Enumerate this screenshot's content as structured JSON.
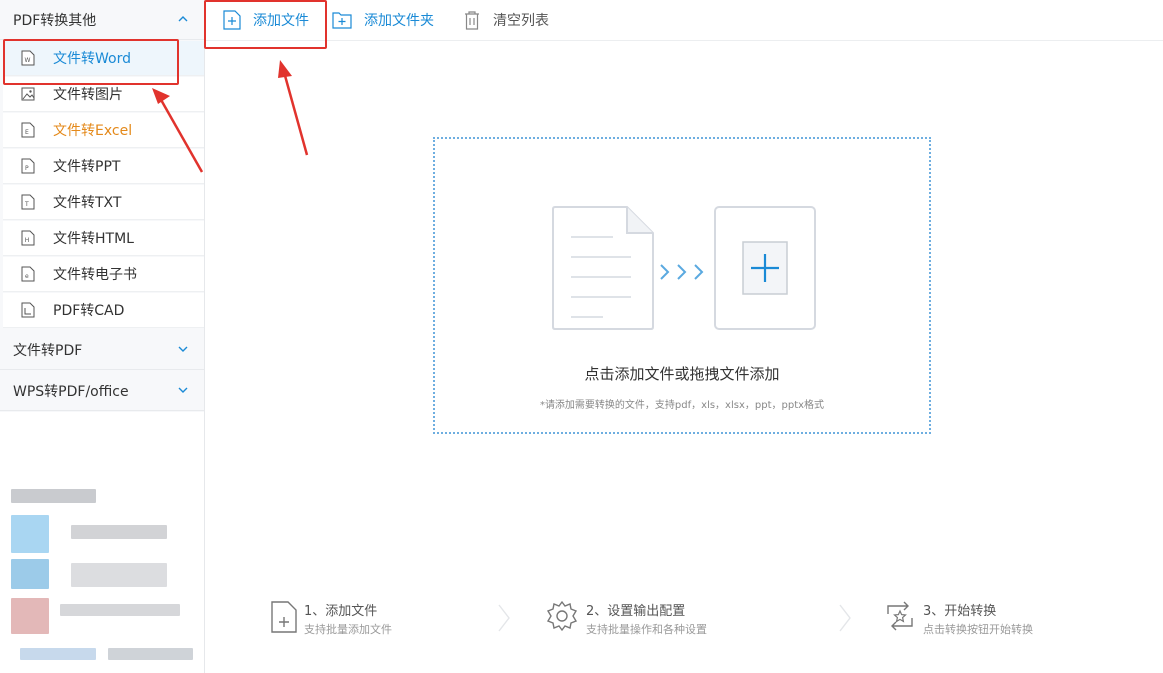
{
  "sidebar": {
    "group1": {
      "label": "PDF转换其他"
    },
    "items": [
      {
        "label": "文件转Word",
        "icon": "word-file-icon"
      },
      {
        "label": "文件转图片",
        "icon": "image-file-icon"
      },
      {
        "label": "文件转Excel",
        "icon": "excel-file-icon"
      },
      {
        "label": "文件转PPT",
        "icon": "ppt-file-icon"
      },
      {
        "label": "文件转TXT",
        "icon": "txt-file-icon"
      },
      {
        "label": "文件转HTML",
        "icon": "html-file-icon"
      },
      {
        "label": "文件转电子书",
        "icon": "ebook-file-icon"
      },
      {
        "label": "PDF转CAD",
        "icon": "cad-file-icon"
      }
    ],
    "group2": {
      "label": "文件转PDF"
    },
    "group3": {
      "label": "WPS转PDF/office"
    }
  },
  "toolbar": {
    "add_file": "添加文件",
    "add_folder": "添加文件夹",
    "clear_list": "清空列表"
  },
  "dropzone": {
    "title": "点击添加文件或拖拽文件添加",
    "hint": "*请添加需要转换的文件，支持pdf，xls，xlsx，ppt，pptx格式"
  },
  "steps": [
    {
      "title": "1、添加文件",
      "sub": "支持批量添加文件"
    },
    {
      "title": "2、设置输出配置",
      "sub": "支持批量操作和各种设置"
    },
    {
      "title": "3、开始转换",
      "sub": "点击转换按钮开始转换"
    }
  ],
  "colors": {
    "accent": "#1a8ad6",
    "excel": "#e4891a",
    "annotation": "#e1332d"
  }
}
